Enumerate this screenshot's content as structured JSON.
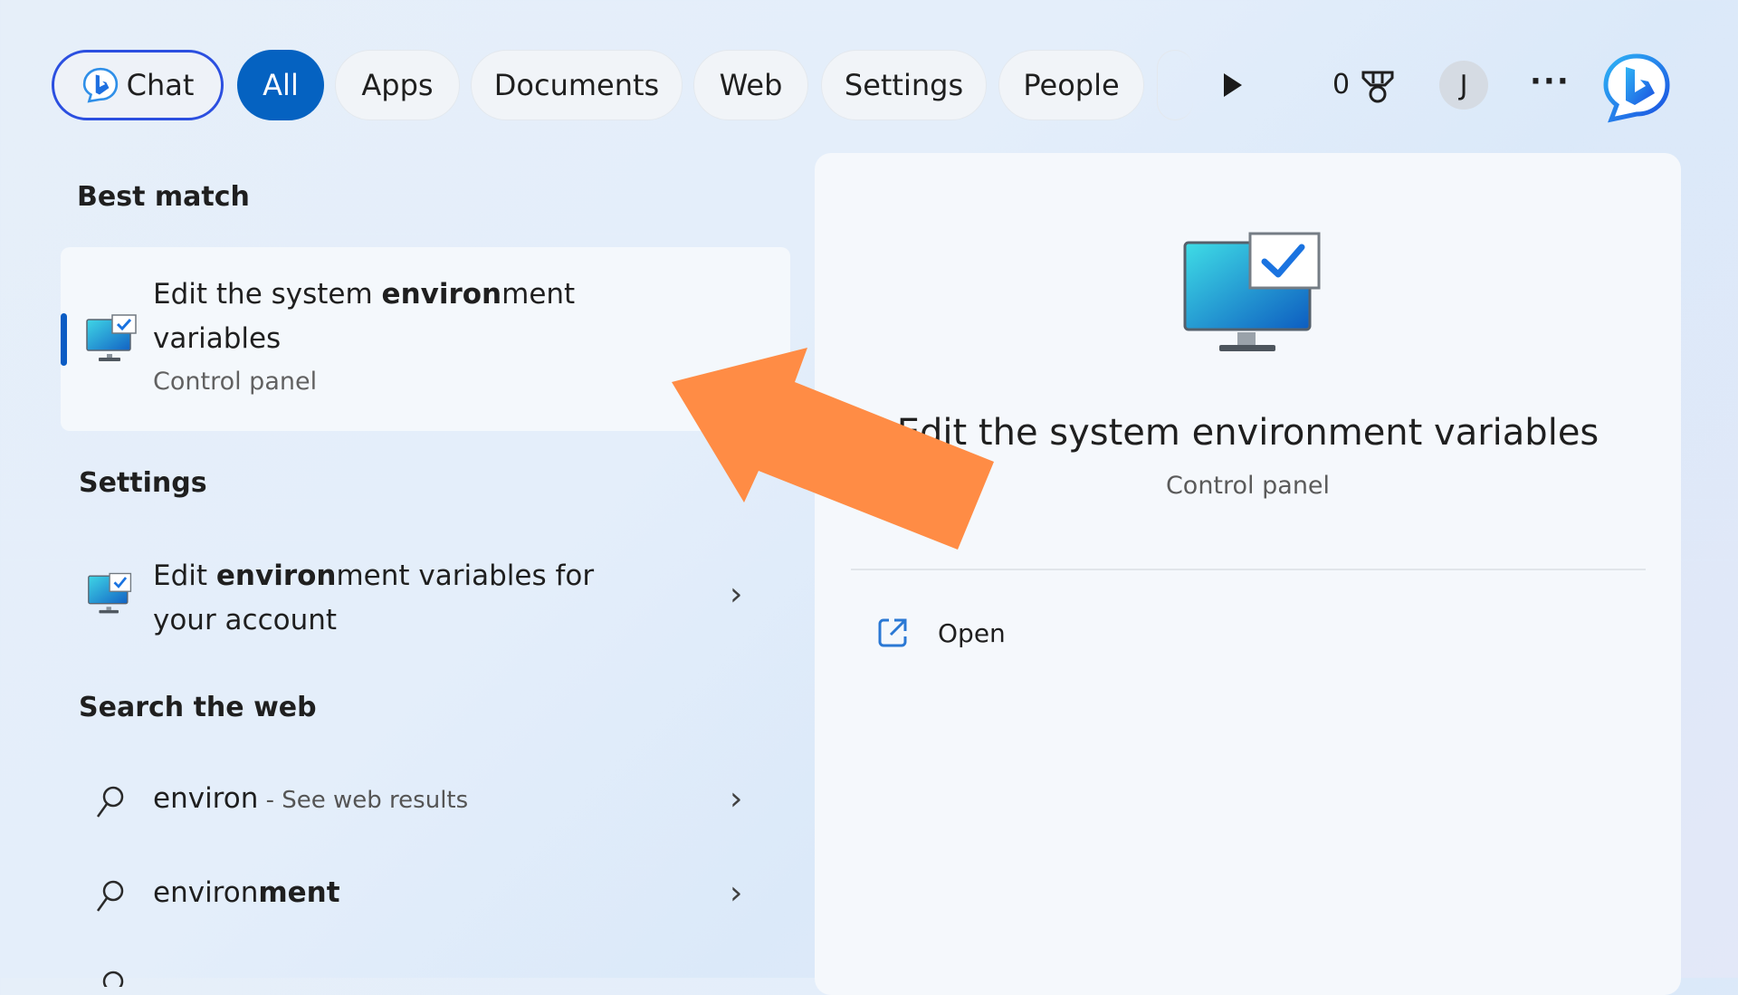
{
  "filter_bar": {
    "chat_label": "Chat",
    "tabs": [
      {
        "label": "All",
        "active": true
      },
      {
        "label": "Apps",
        "active": false
      },
      {
        "label": "Documents",
        "active": false
      },
      {
        "label": "Web",
        "active": false
      },
      {
        "label": "Settings",
        "active": false
      },
      {
        "label": "People",
        "active": false
      }
    ],
    "rewards_count": "0",
    "avatar_initial": "J",
    "more_label": "···",
    "accent_color": "#0562c1"
  },
  "best_match": {
    "header": "Best match",
    "title_pre": "Edit the system ",
    "title_bold": "environ",
    "title_post": "ment",
    "title_line2": "variables",
    "subtitle": "Control panel",
    "icon": "system-settings-monitor-icon"
  },
  "settings": {
    "header": "Settings",
    "items": [
      {
        "pre": "Edit ",
        "bold": "environ",
        "post": "ment variables for",
        "line2": "your account",
        "icon": "system-settings-monitor-icon"
      }
    ]
  },
  "web": {
    "header": "Search the web",
    "items": [
      {
        "query": "environ",
        "suffix": " - See web results"
      },
      {
        "query_pre": "environ",
        "query_bold": "ment",
        "suffix": ""
      }
    ]
  },
  "details": {
    "title": "Edit the system environment variables",
    "subtitle": "Control panel",
    "actions": [
      {
        "label": "Open",
        "icon": "open-external-icon"
      }
    ]
  },
  "annotation": {
    "type": "arrow",
    "color": "#ff8c45",
    "points_to": "best-match-result"
  }
}
